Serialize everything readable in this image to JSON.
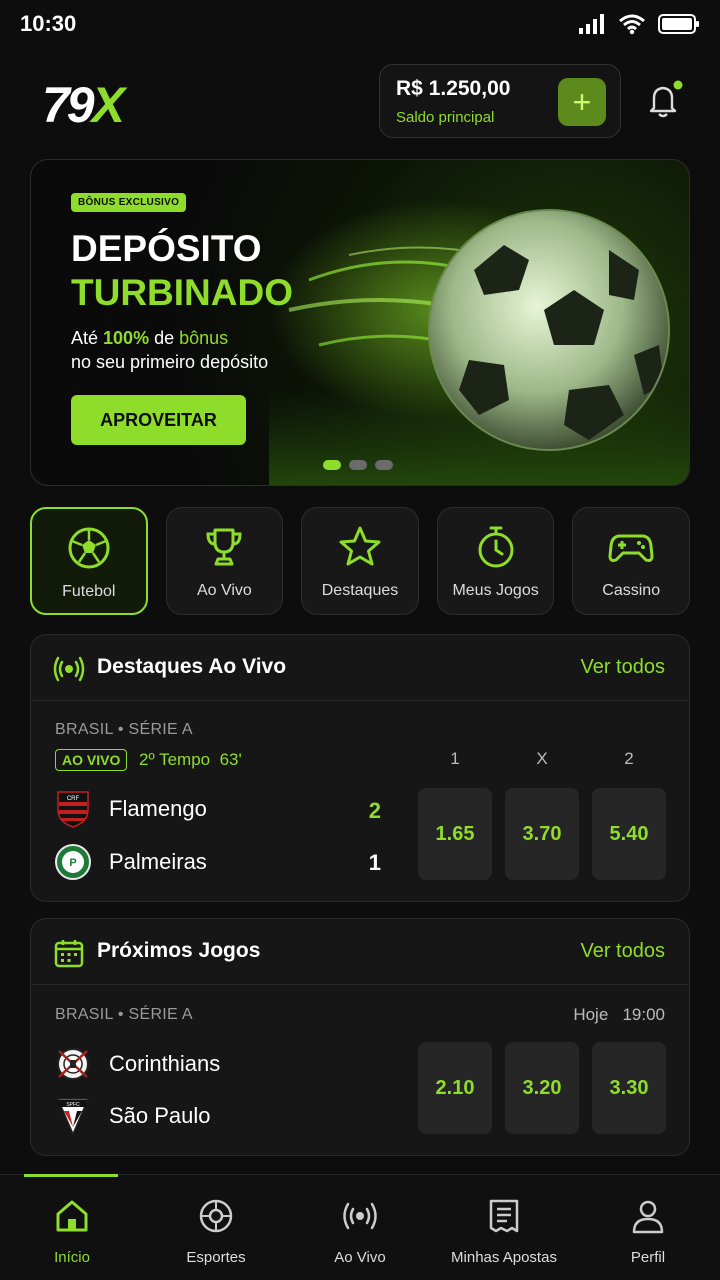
{
  "status": {
    "time": "10:30"
  },
  "header": {
    "logo_main": "79",
    "logo_accent": "X",
    "balance_amount": "R$ 1.250,00",
    "balance_label": "Saldo principal",
    "add_label": "+"
  },
  "banner": {
    "badge": "BÔNUS EXCLUSIVO",
    "title_line1": "DEPÓSITO",
    "title_line2": "TURBINADO",
    "desc_pre": "Até ",
    "desc_pct": "100%",
    "desc_mid": " de ",
    "desc_bonus": "bônus",
    "desc_line2": "no seu primeiro depósito",
    "cta": "APROVEITAR"
  },
  "categories": [
    {
      "label": "Futebol",
      "icon": "soccer-ball-icon"
    },
    {
      "label": "Ao Vivo",
      "icon": "trophy-icon"
    },
    {
      "label": "Destaques",
      "icon": "star-icon"
    },
    {
      "label": "Meus Jogos",
      "icon": "stopwatch-icon"
    },
    {
      "label": "Cassino",
      "icon": "gamepad-icon"
    }
  ],
  "live": {
    "title": "Destaques Ao Vivo",
    "see_all": "Ver todos",
    "league": "BRASIL • SÉRIE A",
    "live_tag": "AO VIVO",
    "period": "2º Tempo",
    "minute": "63'",
    "columns": [
      "1",
      "X",
      "2"
    ],
    "home": {
      "name": "Flamengo",
      "score": "2"
    },
    "away": {
      "name": "Palmeiras",
      "score": "1"
    },
    "odds": [
      "1.65",
      "3.70",
      "5.40"
    ]
  },
  "upcoming": {
    "title": "Próximos Jogos",
    "see_all": "Ver todos",
    "league": "BRASIL • SÉRIE A",
    "day": "Hoje",
    "time": "19:00",
    "home": {
      "name": "Corinthians"
    },
    "away": {
      "name": "São Paulo"
    },
    "odds": [
      "2.10",
      "3.20",
      "3.30"
    ]
  },
  "nav": [
    {
      "label": "Início",
      "icon": "home-icon"
    },
    {
      "label": "Esportes",
      "icon": "sports-ball-icon"
    },
    {
      "label": "Ao Vivo",
      "icon": "broadcast-icon"
    },
    {
      "label": "Minhas Apostas",
      "icon": "betslip-icon"
    },
    {
      "label": "Perfil",
      "icon": "user-icon"
    }
  ],
  "colors": {
    "accent": "#8fdd2b",
    "background": "#0d0d0d",
    "card": "#161616"
  }
}
